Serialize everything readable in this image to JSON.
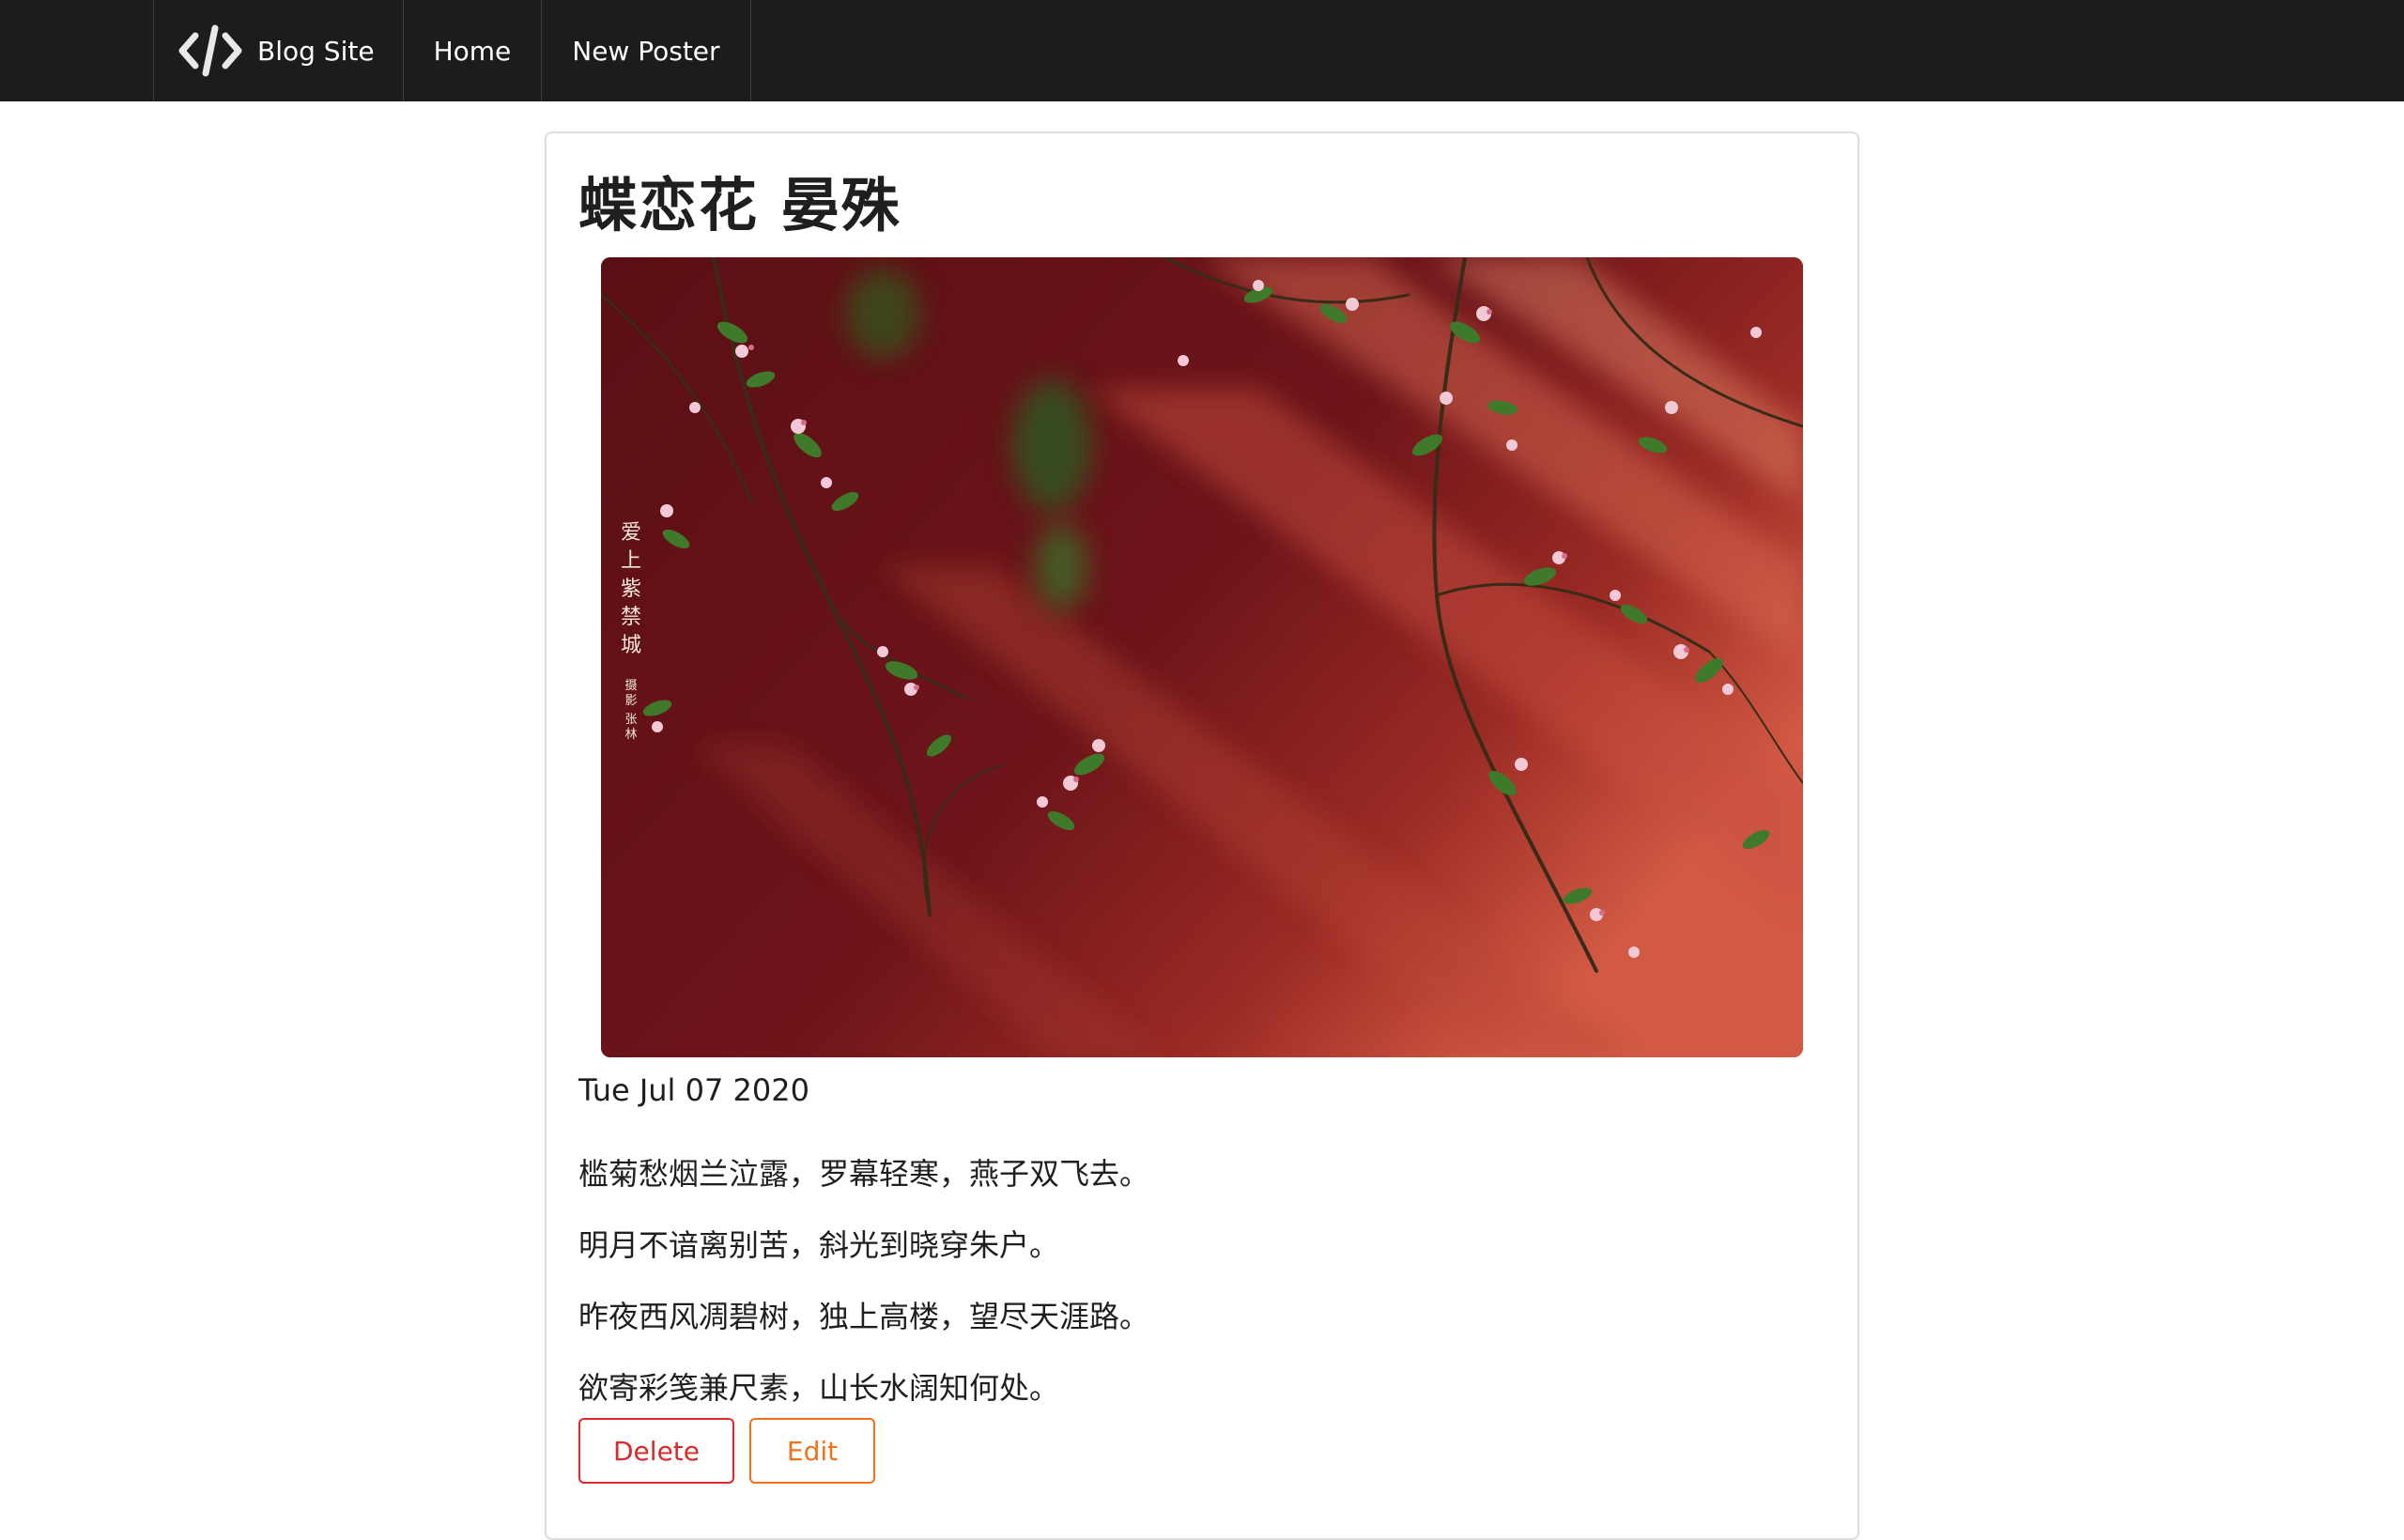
{
  "nav": {
    "brand_label": "Blog Site",
    "brand_icon": "code-icon",
    "items": [
      {
        "label": "Home"
      },
      {
        "label": "New Poster"
      }
    ]
  },
  "post": {
    "title": "蝶恋花 晏殊",
    "image": {
      "description_icon": "photo-crabapple-blossoms-red-wall",
      "overlay_text": "爱上紫禁城",
      "overlay_credit": "摄影 张林"
    },
    "date": "Tue Jul 07 2020",
    "lines": [
      "槛菊愁烟兰泣露，罗幕轻寒，燕子双飞去。",
      "明月不谙离别苦，斜光到晓穿朱户。",
      "昨夜西风凋碧树，独上高楼，望尽天涯路。",
      "欲寄彩笺兼尺素，山长水阔知何处。"
    ]
  },
  "actions": {
    "delete_label": "Delete",
    "edit_label": "Edit"
  },
  "colors": {
    "nav_bg": "#1b1c1d",
    "delete": "#db2828",
    "edit": "#f2711c",
    "wall_red": "#8a1c1c"
  }
}
